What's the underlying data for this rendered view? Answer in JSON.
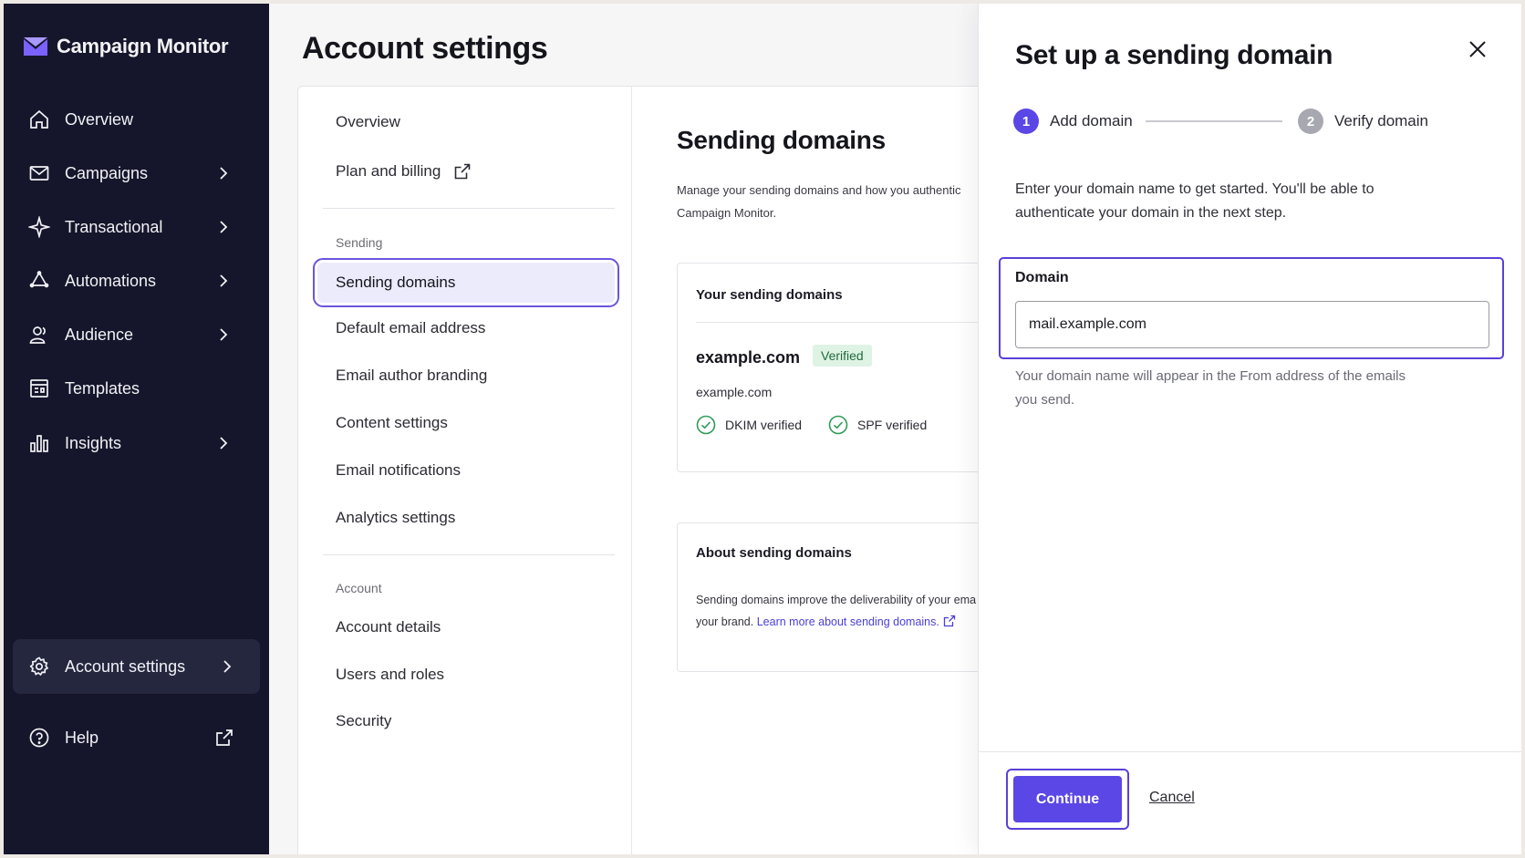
{
  "brand": {
    "name": "Campaign Monitor",
    "logo_icon": "envelope-logo-icon",
    "accent": "#7b61ff"
  },
  "sidebar": {
    "items": [
      {
        "label": "Overview",
        "icon": "home-icon",
        "has_submenu": false
      },
      {
        "label": "Campaigns",
        "icon": "mail-icon",
        "has_submenu": true
      },
      {
        "label": "Transactional",
        "icon": "sparkle-icon",
        "has_submenu": true
      },
      {
        "label": "Automations",
        "icon": "automation-icon",
        "has_submenu": true
      },
      {
        "label": "Audience",
        "icon": "users-icon",
        "has_submenu": true
      },
      {
        "label": "Templates",
        "icon": "template-icon",
        "has_submenu": false
      },
      {
        "label": "Insights",
        "icon": "bar-chart-icon",
        "has_submenu": true
      }
    ],
    "account_settings": {
      "label": "Account settings",
      "icon": "gear-icon"
    },
    "help": {
      "label": "Help",
      "icon": "help-icon"
    }
  },
  "page": {
    "title": "Account settings"
  },
  "subnav": {
    "top_items": [
      {
        "label": "Overview"
      },
      {
        "label": "Plan and billing"
      }
    ],
    "sending_heading": "Sending",
    "sending_items": [
      {
        "label": "Sending domains"
      },
      {
        "label": "Default email address"
      },
      {
        "label": "Email author branding"
      },
      {
        "label": "Content settings"
      },
      {
        "label": "Email notifications"
      },
      {
        "label": "Analytics settings"
      }
    ],
    "account_heading": "Account",
    "account_items": [
      {
        "label": "Account details"
      },
      {
        "label": "Users and roles"
      },
      {
        "label": "Security"
      }
    ]
  },
  "content": {
    "title": "Sending domains",
    "description_line1": "Manage your sending domains and how you authentic",
    "description_line2": "Campaign Monitor.",
    "your_domains": {
      "title": "Your sending domains",
      "domain": "example.com",
      "badge": "Verified",
      "subdomain": "example.com",
      "checks": [
        "DKIM verified",
        "SPF verified"
      ]
    },
    "about": {
      "title": "About sending domains",
      "line1": "Sending domains improve the deliverability of your ema",
      "line2_prefix": "your brand. ",
      "link": "Learn more about sending domains."
    }
  },
  "panel": {
    "title": "Set up a sending domain",
    "steps": [
      {
        "number": "1",
        "label": "Add domain",
        "active": true
      },
      {
        "number": "2",
        "label": "Verify domain",
        "active": false
      }
    ],
    "intro": "Enter your domain name to get started. You'll be able to authenticate your domain in the next step.",
    "field": {
      "label": "Domain",
      "value": "mail.example.com"
    },
    "help": "Your domain name will appear in the From address of the emails you send.",
    "continue_label": "Continue",
    "cancel_label": "Cancel"
  }
}
